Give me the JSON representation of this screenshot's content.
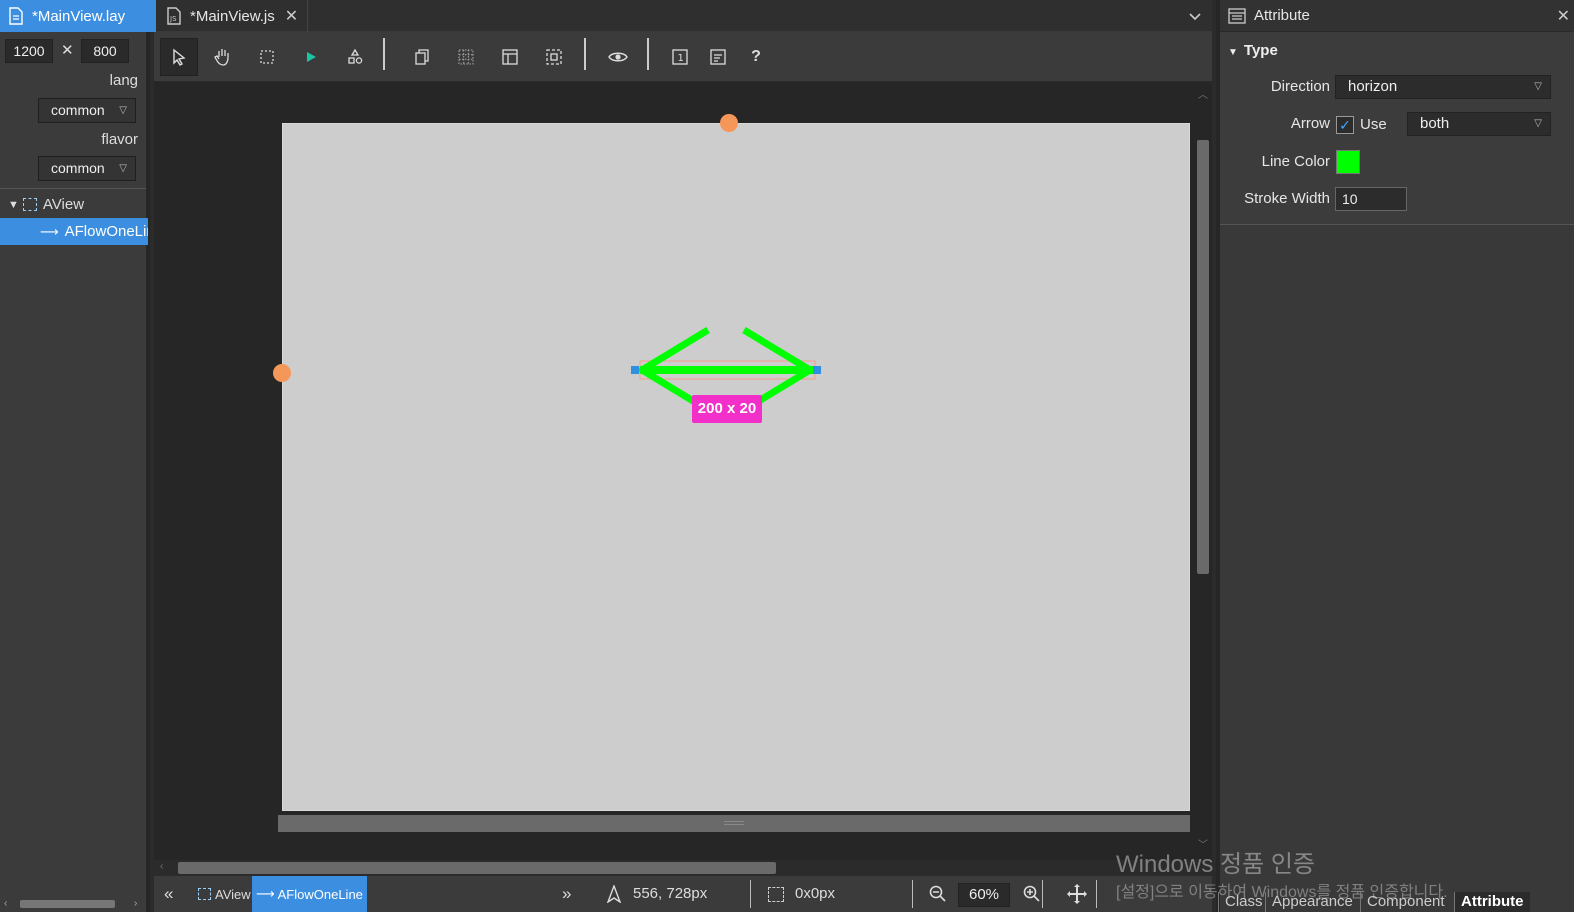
{
  "tabs": [
    {
      "label": "*MainView.lay",
      "active": true
    },
    {
      "label": "*MainView.js",
      "active": false
    }
  ],
  "left": {
    "width_value": "1200",
    "times": "✕",
    "height_value": "800",
    "lang_label": "lang",
    "lang_value": "common",
    "flavor_label": "flavor",
    "flavor_value": "common",
    "tree": [
      {
        "label": "AView"
      },
      {
        "label": "AFlowOneLine"
      }
    ]
  },
  "toolbar": {
    "help_label": "?"
  },
  "canvas": {
    "size_badge": "200 x 20",
    "line_color": "#00ff00"
  },
  "status": {
    "crumb1": "AView",
    "crumb2": "AFlowOneLine",
    "position": "556, 728px",
    "selection_size": "0x0px",
    "zoom": "60%"
  },
  "right": {
    "header": "Attribute",
    "section": "Type",
    "direction_label": "Direction",
    "direction_value": "horizon",
    "arrow_label": "Arrow",
    "arrow_use_label": "Use",
    "arrow_value": "both",
    "line_color_label": "Line Color",
    "line_color_value": "#00ff00",
    "stroke_width_label": "Stroke Width",
    "stroke_width_value": "10",
    "bottom_tabs": [
      "Class",
      "Appearance",
      "Component",
      "Attribute"
    ]
  },
  "watermark": {
    "line1": "Windows 정품 인증",
    "line2": "[설정]으로 이동하여 Windows를 정품 인증합니다."
  }
}
